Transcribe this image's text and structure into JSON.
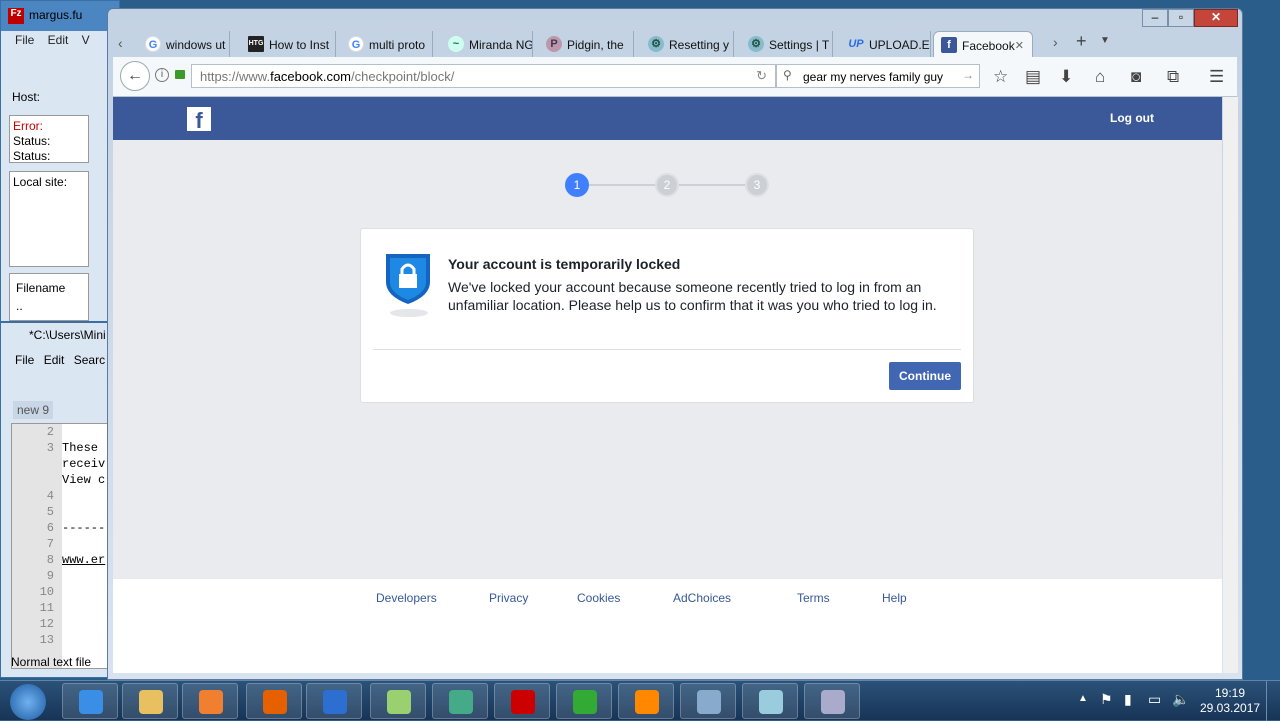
{
  "filezilla": {
    "title": "margus.fu",
    "menu": "File Edit V",
    "host_label": "Host:",
    "log": [
      "Error:",
      "Status:",
      "Status:"
    ],
    "local_site": "Local site:",
    "filename_header": "Filename",
    "parent_dir": ".."
  },
  "notepad": {
    "title": "*C:\\Users\\Mini",
    "menu": [
      "File",
      "Edit",
      "Searc"
    ],
    "tab": "new 9",
    "line_numbers": [
      "2",
      "3",
      "",
      "",
      "4",
      "5",
      "6",
      "7",
      "8",
      "9",
      "10",
      "11",
      "12",
      "13"
    ],
    "code_lines": [
      "",
      "These",
      "receiv",
      "View c",
      "",
      "",
      "------",
      "",
      "www.er",
      "",
      "",
      "",
      "",
      ""
    ],
    "status": "Normal text file"
  },
  "browser": {
    "tabs": [
      {
        "label": "windows ut",
        "icon": "google-icon"
      },
      {
        "label": "How to Inst",
        "icon": "htg-icon"
      },
      {
        "label": "multi proto",
        "icon": "google-icon"
      },
      {
        "label": "Miranda NG",
        "icon": "miranda-icon"
      },
      {
        "label": "Pidgin, the",
        "icon": "pidgin-icon"
      },
      {
        "label": "Resetting y",
        "icon": "gears-icon"
      },
      {
        "label": "Settings | T",
        "icon": "gears-icon"
      },
      {
        "label": "UPLOAD.EE",
        "icon": "upload-icon"
      },
      {
        "label": "Facebook",
        "icon": "facebook-icon",
        "active": true
      }
    ],
    "url_prefix": "https://www.",
    "url_domain": "facebook.com",
    "url_path": "/checkpoint/block/",
    "search_value": "gear my nerves family guy"
  },
  "facebook": {
    "logout": "Log out",
    "steps": [
      "1",
      "2",
      "3"
    ],
    "active_step": 1,
    "accent": "#3b5998",
    "title": "Your account is temporarily locked",
    "message": "We've locked your account because someone recently tried to log in from an unfamiliar location. Please help us to confirm that it was you who tried to log in.",
    "continue": "Continue",
    "footer": [
      "Developers",
      "Privacy",
      "Cookies",
      "AdChoices",
      "Terms",
      "Help"
    ]
  },
  "taskbar": {
    "time": "19:19",
    "date": "29.03.2017"
  }
}
